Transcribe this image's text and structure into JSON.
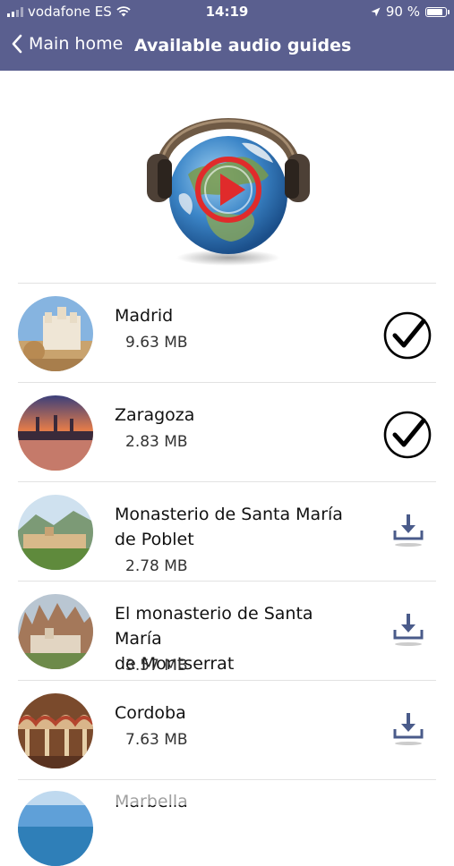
{
  "status_bar": {
    "carrier": "vodafone ES",
    "time": "14:19",
    "battery_percent": "90 %",
    "battery_level": 0.9
  },
  "nav": {
    "back_label": "Main home",
    "title": "Available audio guides"
  },
  "colors": {
    "header": "#5a5f8f",
    "download_icon": "#4a5b8a",
    "play_red": "#e02b2b"
  },
  "guides": [
    {
      "name": "Madrid",
      "size": "9.63 MB",
      "status": "downloaded",
      "icon": "check-circle-icon"
    },
    {
      "name": "Zaragoza",
      "size": "2.83 MB",
      "status": "downloaded",
      "icon": "check-circle-icon"
    },
    {
      "name_line1": "Monasterio de Santa María",
      "name_line2": "de Poblet",
      "size": "2.78 MB",
      "status": "available",
      "icon": "download-icon"
    },
    {
      "name_line1": "El monasterio de Santa María",
      "name_line2": "de Montserrat",
      "size": "3.57 MB",
      "status": "available",
      "icon": "download-icon"
    },
    {
      "name": "Cordoba",
      "size": "7.63 MB",
      "status": "available",
      "icon": "download-icon"
    },
    {
      "name": "Marbella",
      "status": "partially-visible"
    }
  ]
}
